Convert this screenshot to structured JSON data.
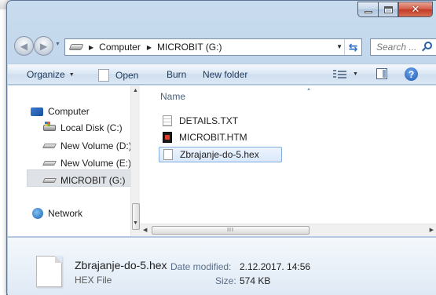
{
  "window": {
    "colors": {
      "frame": "#b5cde6",
      "close": "#c13a25",
      "selection": "#d9e8fb"
    }
  },
  "address": {
    "crumbs": [
      "Computer",
      "MICROBIT (G:)"
    ]
  },
  "search": {
    "placeholder": "Search ..."
  },
  "toolbar": {
    "organize": "Organize",
    "open": "Open",
    "burn": "Burn",
    "new_folder": "New folder"
  },
  "navpane": {
    "items": [
      {
        "label": "Computer",
        "icon": "computer-icon"
      },
      {
        "label": "Local Disk (C:)",
        "icon": "local-disk-icon"
      },
      {
        "label": "New Volume (D:)",
        "icon": "drive-icon"
      },
      {
        "label": "New Volume (E:)",
        "icon": "drive-icon"
      },
      {
        "label": "MICROBIT (G:)",
        "icon": "usb-drive-icon"
      },
      {
        "label": "Network",
        "icon": "network-icon"
      }
    ]
  },
  "filelist": {
    "column": "Name",
    "files": [
      {
        "name": "DETAILS.TXT",
        "icon": "text-file-icon"
      },
      {
        "name": "MICROBIT.HTM",
        "icon": "html-file-icon"
      },
      {
        "name": "Zbrajanje-do-5.hex",
        "icon": "hex-file-icon",
        "selected": true
      }
    ]
  },
  "details": {
    "name": "Zbrajanje-do-5.hex",
    "type": "HEX File",
    "modified_label": "Date modified:",
    "modified_value": "2.12.2017. 14:56",
    "size_label": "Size:",
    "size_value": "574 KB"
  }
}
